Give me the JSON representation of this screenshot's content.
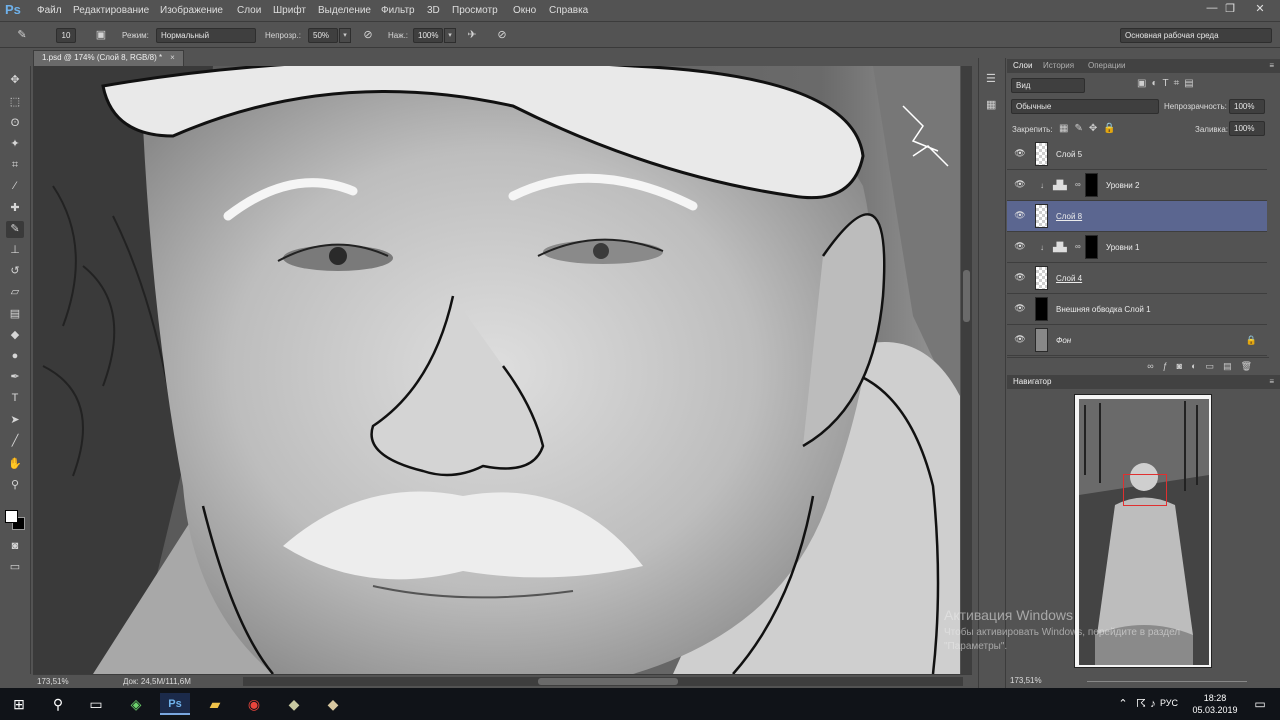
{
  "menubar": {
    "logo": "Ps",
    "items": [
      "Файл",
      "Редактирование",
      "Изображение",
      "Слои",
      "Шрифт",
      "Выделение",
      "Фильтр",
      "3D",
      "Просмотр",
      "Окно",
      "Справка"
    ],
    "window_buttons": [
      "—",
      "❐",
      "✕"
    ]
  },
  "options": {
    "brush_size": "10",
    "mode_label": "Режим:",
    "mode_value": "Нормальный",
    "opacity_label": "Непрозр.:",
    "opacity_value": "50%",
    "flow_label": "Наж.:",
    "flow_value": "100%",
    "workspace": "Основная рабочая среда"
  },
  "document": {
    "tab_title": "1.psd @ 174% (Слой 8, RGB/8) *",
    "close": "×"
  },
  "status": {
    "zoom": "173,51%",
    "doc": "Док: 24,5M/111,6M"
  },
  "layers_panel": {
    "tabs": [
      "Слои",
      "История",
      "Операции"
    ],
    "menu_icon": "≡",
    "filter_label": "Вид",
    "blend_mode": "Обычные",
    "opacity_label": "Непрозрачность:",
    "opacity_value": "100%",
    "lock_label": "Закрепить:",
    "fill_label": "Заливка:",
    "fill_value": "100%",
    "layers": [
      {
        "name": "Слой 5",
        "type": "pixel",
        "selected": false,
        "underline": false
      },
      {
        "name": "Уровни 2",
        "type": "adjustment",
        "selected": false,
        "underline": false
      },
      {
        "name": "Слой 8",
        "type": "pixel",
        "selected": true,
        "underline": true
      },
      {
        "name": "Уровни 1",
        "type": "adjustment",
        "selected": false,
        "underline": false
      },
      {
        "name": "Слой 4",
        "type": "pixel",
        "selected": false,
        "underline": true
      },
      {
        "name": "Внешняя обводка Слой 1",
        "type": "pixel",
        "selected": false,
        "underline": false
      },
      {
        "name": "Фон",
        "type": "background",
        "selected": false,
        "underline": false
      }
    ]
  },
  "navigator": {
    "title": "Навигатор",
    "zoom": "173,51%"
  },
  "activation": {
    "title": "Активация Windows",
    "text": "Чтобы активировать Windows, перейдите в раздел \"Параметры\"."
  },
  "taskbar": {
    "lang": "РУС",
    "time": "18:28",
    "date": "05.03.2019"
  },
  "colors": {
    "panel_bg": "#535353",
    "selected_layer": "#5b6690",
    "nav_box": "#e03030",
    "ps_blue": "#6fb1ea"
  }
}
